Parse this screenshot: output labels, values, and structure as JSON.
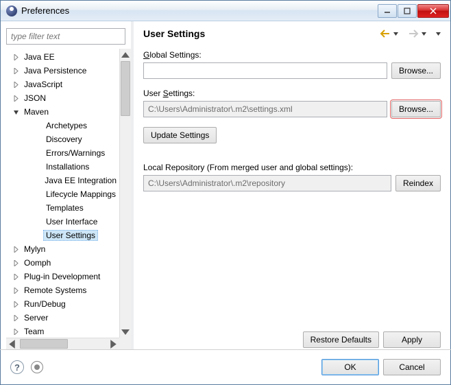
{
  "window": {
    "title": "Preferences"
  },
  "filter": {
    "placeholder": "type filter text"
  },
  "tree": {
    "items": [
      {
        "label": "Java EE",
        "level": 1,
        "expand": "closed"
      },
      {
        "label": "Java Persistence",
        "level": 1,
        "expand": "closed"
      },
      {
        "label": "JavaScript",
        "level": 1,
        "expand": "closed"
      },
      {
        "label": "JSON",
        "level": 1,
        "expand": "closed"
      },
      {
        "label": "Maven",
        "level": 1,
        "expand": "open"
      },
      {
        "label": "Archetypes",
        "level": 2,
        "expand": "none"
      },
      {
        "label": "Discovery",
        "level": 2,
        "expand": "none"
      },
      {
        "label": "Errors/Warnings",
        "level": 2,
        "expand": "none"
      },
      {
        "label": "Installations",
        "level": 2,
        "expand": "none"
      },
      {
        "label": "Java EE Integration",
        "level": 2,
        "expand": "none"
      },
      {
        "label": "Lifecycle Mappings",
        "level": 2,
        "expand": "none"
      },
      {
        "label": "Templates",
        "level": 2,
        "expand": "none"
      },
      {
        "label": "User Interface",
        "level": 2,
        "expand": "none"
      },
      {
        "label": "User Settings",
        "level": 2,
        "expand": "none",
        "selected": true
      },
      {
        "label": "Mylyn",
        "level": 1,
        "expand": "closed"
      },
      {
        "label": "Oomph",
        "level": 1,
        "expand": "closed"
      },
      {
        "label": "Plug-in Development",
        "level": 1,
        "expand": "closed"
      },
      {
        "label": "Remote Systems",
        "level": 1,
        "expand": "closed"
      },
      {
        "label": "Run/Debug",
        "level": 1,
        "expand": "closed"
      },
      {
        "label": "Server",
        "level": 1,
        "expand": "closed"
      },
      {
        "label": "Team",
        "level": 1,
        "expand": "closed"
      }
    ]
  },
  "page": {
    "title": "User Settings",
    "global_label_pre": "",
    "global_label_u": "G",
    "global_label_post": "lobal Settings:",
    "global_value": "",
    "user_label_pre": "User ",
    "user_label_u": "S",
    "user_label_post": "ettings:",
    "user_value": "C:\\Users\\Administrator\\.m2\\settings.xml",
    "update_btn": "Update Settings",
    "repo_label": "Local Repository (From merged user and global settings):",
    "repo_value": "C:\\Users\\Administrator\\.m2\\repository",
    "browse": "Browse...",
    "reindex": "Reindex",
    "restore": "Restore Defaults",
    "apply": "Apply"
  },
  "footer": {
    "ok": "OK",
    "cancel": "Cancel"
  }
}
